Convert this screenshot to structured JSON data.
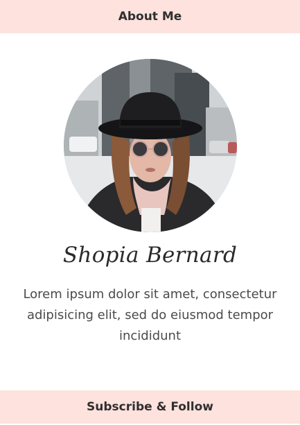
{
  "widget": {
    "header_title": "About Me",
    "profile": {
      "name": "Shopia Bernard",
      "bio": "Lorem ipsum dolor sit amet, consectetur adipisicing elit, sed do eiusmod tempor incididunt",
      "photo_alt": "profile photo of woman in black hat and round sunglasses"
    },
    "footer_title": "Subscribe & Follow"
  },
  "colors": {
    "bar_background": "#fde2dd",
    "heading_text": "#2f2f2f",
    "body_text": "#4a4a4a"
  }
}
